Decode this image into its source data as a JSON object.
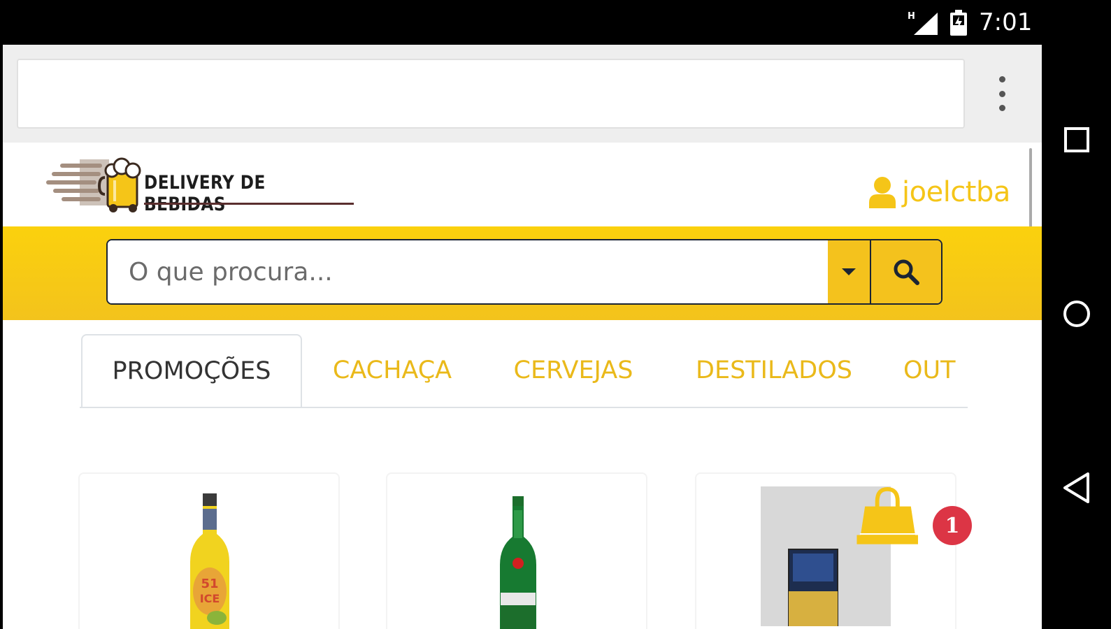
{
  "status_bar": {
    "network": "H",
    "time": "7:01"
  },
  "header": {
    "logo_text": "DELIVERY DE BEBIDAS",
    "username": "joelctba"
  },
  "search": {
    "placeholder": "O que procura..."
  },
  "tabs": [
    {
      "label": "PROMOÇÕES",
      "active": true
    },
    {
      "label": "CACHAÇA",
      "active": false
    },
    {
      "label": "CERVEJAS",
      "active": false
    },
    {
      "label": "DESTILADOS",
      "active": false
    },
    {
      "label": "OUT",
      "active": false
    }
  ],
  "cart": {
    "count": "1"
  },
  "colors": {
    "brand_yellow": "#fbd10d",
    "accent_text": "#eab91a",
    "badge_red": "#dc3545",
    "dark_border": "#1b2433"
  },
  "products": [
    {
      "icon": "yellow-bottle"
    },
    {
      "icon": "green-bottle"
    },
    {
      "icon": "cigarette-pack"
    }
  ]
}
